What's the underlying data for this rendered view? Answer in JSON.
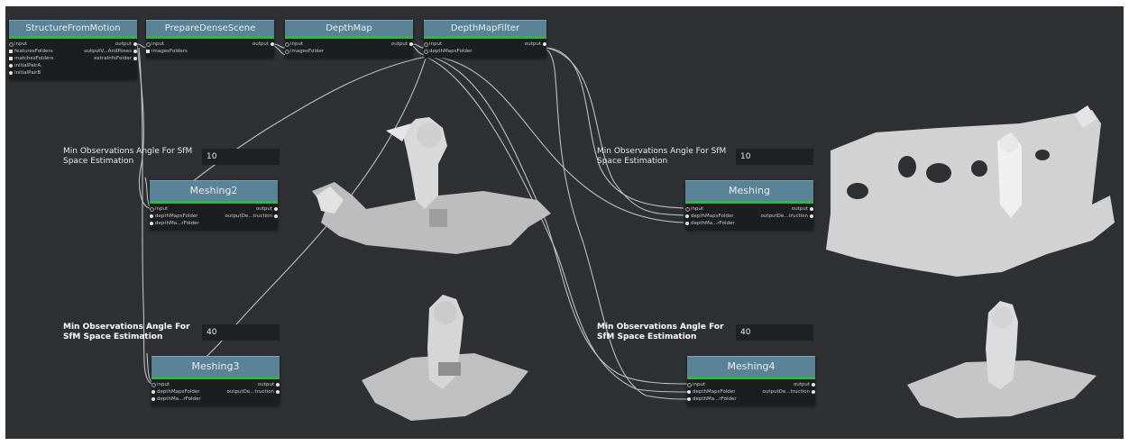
{
  "nodes": {
    "sfm": {
      "title": "StructureFromMotion",
      "left_ports": [
        "input",
        "featuresFolders",
        "matchesFolders",
        "initialPairA",
        "initialPairB"
      ],
      "right_ports": [
        "output",
        "outputV...AndPoses",
        "extraInfoFolder"
      ]
    },
    "pds": {
      "title": "PrepareDenseScene",
      "left_ports": [
        "input",
        "imagesFolders"
      ],
      "right_ports": [
        "output"
      ]
    },
    "dm": {
      "title": "DepthMap",
      "left_ports": [
        "input",
        "imagesFolder"
      ],
      "right_ports": [
        "output"
      ]
    },
    "dmf": {
      "title": "DepthMapFilter",
      "left_ports": [
        "input",
        "depthMapsFolder"
      ],
      "right_ports": [
        "output"
      ]
    },
    "meshing2": {
      "title": "Meshing2",
      "left_ports": [
        "input",
        "depthMapsFolder",
        "depthMa...rFolder"
      ],
      "right_ports": [
        "output",
        "outputDe...truction"
      ]
    },
    "meshing": {
      "title": "Meshing",
      "left_ports": [
        "input",
        "depthMapsFolder",
        "depthMa...rFolder"
      ],
      "right_ports": [
        "output",
        "outputDe...truction"
      ]
    },
    "meshing3": {
      "title": "Meshing3",
      "left_ports": [
        "input",
        "depthMapsFolder",
        "depthMa...rFolder"
      ],
      "right_ports": [
        "output",
        "outputDe...truction"
      ]
    },
    "meshing4": {
      "title": "Meshing4",
      "left_ports": [
        "input",
        "depthMapsFolder",
        "depthMa...rFolder"
      ],
      "right_ports": [
        "output",
        "outputDe...truction"
      ]
    }
  },
  "params": {
    "p1": {
      "label_line1": "Min Observations Angle For SfM",
      "label_line2": "Space Estimation",
      "value": "10"
    },
    "p2": {
      "label_line1": "Min Observations Angle For SfM",
      "label_line2": "Space Estimation",
      "value": "10"
    },
    "p3": {
      "label_line1": "Min Observations Angle For",
      "label_line2": "SfM Space Estimation",
      "value": "40"
    },
    "p4": {
      "label_line1": "Min Observations Angle For",
      "label_line2": "SfM Space Estimation",
      "value": "40"
    }
  },
  "colors": {
    "canvas": "#2f3033",
    "node_title": "#5a8398",
    "node_status": "#35b34a",
    "mesh": "#d6d6d6"
  }
}
